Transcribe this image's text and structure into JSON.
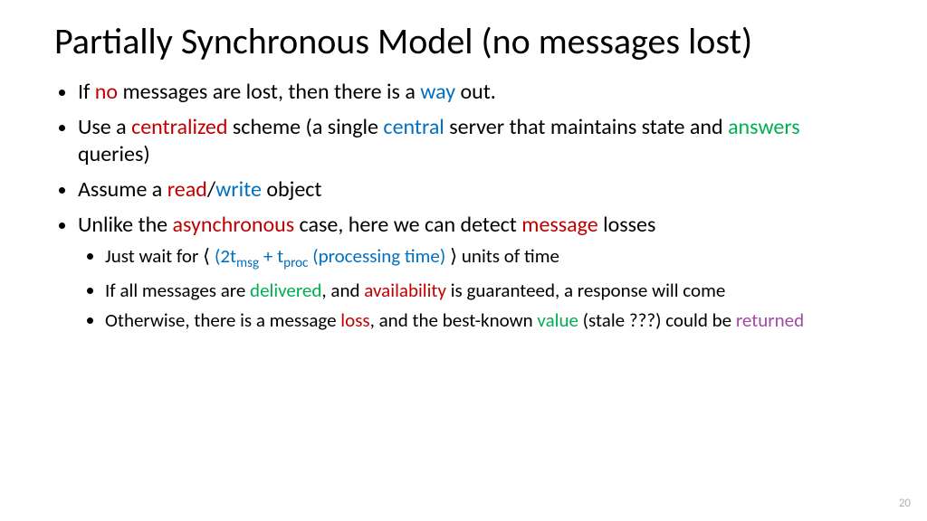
{
  "title": "Partially Synchronous Model (no messages lost)",
  "b1": {
    "pre": "If ",
    "no": "no",
    "mid": " messages are lost, then there is a ",
    "way": "way",
    "post": " out."
  },
  "b2": {
    "pre": "Use a ",
    "centralized": "centralized",
    "mid1": " scheme (a single ",
    "central": "central",
    "mid2": " server that maintains state and ",
    "answers": "answers",
    "post": " queries)"
  },
  "b3": {
    "pre": "Assume a ",
    "read": "read",
    "slash": "/",
    "write": "write",
    "post": " object"
  },
  "b4": {
    "pre": "Unlike the ",
    "async": "asynchronous",
    "mid": " case, here we can detect ",
    "message": "message",
    "post": " losses"
  },
  "b4a": {
    "pre": "Just wait for ⟨ ",
    "lp": "(2t",
    "sub1": "msg",
    "plus": " + t",
    "sub2": "proc",
    "proc": " (processing time)",
    "post": " ⟩ units of time"
  },
  "b4b": {
    "pre": "If all messages are ",
    "delivered": "delivered",
    "mid": ", and ",
    "avail": "availability",
    "post": " is guaranteed, a response will come"
  },
  "b4c": {
    "pre": "Otherwise, there is a message ",
    "loss": "loss",
    "mid": ", and the best-known ",
    "value": "value",
    "stale": " (stale ???) could be ",
    "returned": "returned"
  },
  "pagenum": "20"
}
